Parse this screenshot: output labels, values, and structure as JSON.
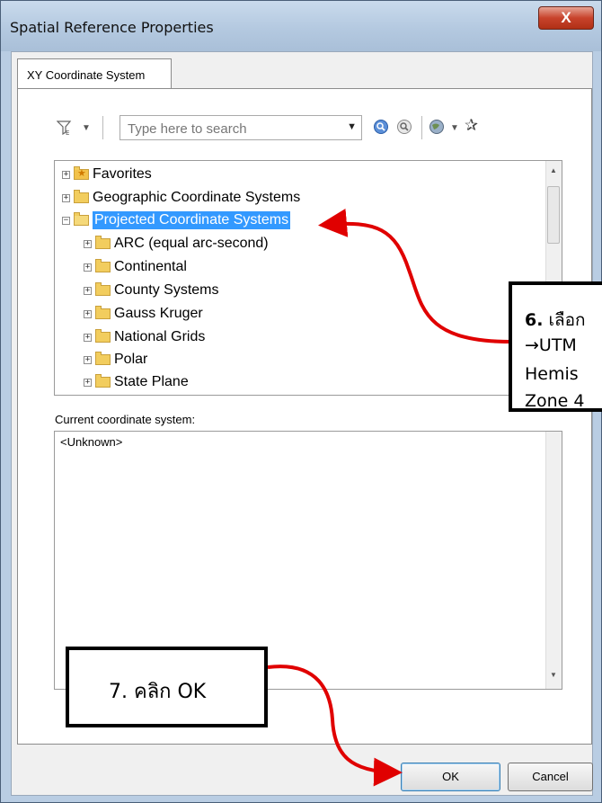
{
  "window": {
    "title": "Spatial Reference Properties",
    "close_label": "X"
  },
  "tabs": [
    {
      "label": "XY Coordinate System"
    }
  ],
  "toolbar": {
    "search_placeholder": "Type here to search"
  },
  "tree": {
    "items": [
      {
        "label": "Favorites",
        "expander": "+",
        "icon": "favorites-folder-icon"
      },
      {
        "label": "Geographic Coordinate Systems",
        "expander": "+",
        "icon": "folder-icon"
      },
      {
        "label": "Projected Coordinate Systems",
        "expander": "−",
        "icon": "open-folder-icon",
        "selected": true
      },
      {
        "label": "ARC (equal arc-second)",
        "expander": "+",
        "icon": "folder-icon"
      },
      {
        "label": "Continental",
        "expander": "+",
        "icon": "folder-icon"
      },
      {
        "label": "County Systems",
        "expander": "+",
        "icon": "folder-icon"
      },
      {
        "label": "Gauss Kruger",
        "expander": "+",
        "icon": "folder-icon"
      },
      {
        "label": "National Grids",
        "expander": "+",
        "icon": "folder-icon"
      },
      {
        "label": "Polar",
        "expander": "+",
        "icon": "folder-icon"
      },
      {
        "label": "State Plane",
        "expander": "+",
        "icon": "folder-icon"
      }
    ]
  },
  "current": {
    "label": "Current coordinate system:",
    "value": "<Unknown>"
  },
  "buttons": {
    "ok": "OK",
    "cancel": "Cancel"
  },
  "annotations": {
    "step6": {
      "number": "6.",
      "line1": "เลือก",
      "arrow": "→",
      "line2": "UTM",
      "line3": "Hemis",
      "line4": "Zone 4"
    },
    "step7": "7. คลิก OK"
  },
  "colors": {
    "selection": "#3399ff",
    "callout_arrow": "#e00000",
    "close_button": "#c8432c"
  }
}
